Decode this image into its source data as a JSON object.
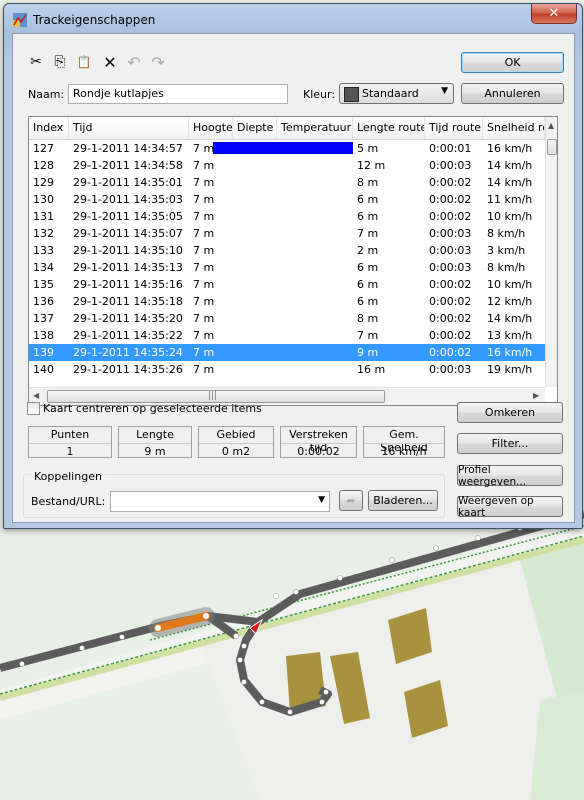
{
  "window": {
    "title": "Trackeigenschappen",
    "close_symbol": "✕"
  },
  "toolbar": {
    "cut": "✂",
    "copy": "⎘",
    "paste": "📋",
    "delete": "✕",
    "undo": "↶",
    "redo": "↷"
  },
  "buttons": {
    "ok": "OK",
    "cancel": "Annuleren",
    "reverse": "Omkeren",
    "filter": "Filter...",
    "profile": "Profiel weergeven...",
    "show_on_map": "Weergeven op kaart",
    "browse": "Bladeren..."
  },
  "form": {
    "name_label": "Naam:",
    "name_value": "Rondje kutlapjes",
    "color_label": "Kleur:",
    "color_value": "Standaard",
    "color_swatch": "#555555"
  },
  "table": {
    "columns": [
      "Index",
      "Tijd",
      "Hoogte",
      "Diepte",
      "Temperatuur",
      "Lengte route",
      "Tijd route",
      "Snelheid rou"
    ],
    "rows": [
      {
        "index": "127",
        "time": "29-1-2011 14:34:57",
        "height": "7 m",
        "depth": "",
        "temp": "",
        "length": "5 m",
        "duration": "0:00:01",
        "speed": "16 km/h"
      },
      {
        "index": "128",
        "time": "29-1-2011 14:34:58",
        "height": "7 m",
        "depth": "",
        "temp": "",
        "length": "12 m",
        "duration": "0:00:03",
        "speed": "14 km/h"
      },
      {
        "index": "129",
        "time": "29-1-2011 14:35:01",
        "height": "7 m",
        "depth": "",
        "temp": "",
        "length": "8 m",
        "duration": "0:00:02",
        "speed": "14 km/h"
      },
      {
        "index": "130",
        "time": "29-1-2011 14:35:03",
        "height": "7 m",
        "depth": "",
        "temp": "",
        "length": "6 m",
        "duration": "0:00:02",
        "speed": "11 km/h"
      },
      {
        "index": "131",
        "time": "29-1-2011 14:35:05",
        "height": "7 m",
        "depth": "",
        "temp": "",
        "length": "6 m",
        "duration": "0:00:02",
        "speed": "10 km/h"
      },
      {
        "index": "132",
        "time": "29-1-2011 14:35:07",
        "height": "7 m",
        "depth": "",
        "temp": "",
        "length": "7 m",
        "duration": "0:00:03",
        "speed": "8 km/h"
      },
      {
        "index": "133",
        "time": "29-1-2011 14:35:10",
        "height": "7 m",
        "depth": "",
        "temp": "",
        "length": "2 m",
        "duration": "0:00:03",
        "speed": "3 km/h"
      },
      {
        "index": "134",
        "time": "29-1-2011 14:35:13",
        "height": "7 m",
        "depth": "",
        "temp": "",
        "length": "6 m",
        "duration": "0:00:03",
        "speed": "8 km/h"
      },
      {
        "index": "135",
        "time": "29-1-2011 14:35:16",
        "height": "7 m",
        "depth": "",
        "temp": "",
        "length": "6 m",
        "duration": "0:00:02",
        "speed": "10 km/h"
      },
      {
        "index": "136",
        "time": "29-1-2011 14:35:18",
        "height": "7 m",
        "depth": "",
        "temp": "",
        "length": "6 m",
        "duration": "0:00:02",
        "speed": "12 km/h"
      },
      {
        "index": "137",
        "time": "29-1-2011 14:35:20",
        "height": "7 m",
        "depth": "",
        "temp": "",
        "length": "8 m",
        "duration": "0:00:02",
        "speed": "14 km/h"
      },
      {
        "index": "138",
        "time": "29-1-2011 14:35:22",
        "height": "7 m",
        "depth": "",
        "temp": "",
        "length": "7 m",
        "duration": "0:00:02",
        "speed": "13 km/h"
      },
      {
        "index": "139",
        "time": "29-1-2011 14:35:24",
        "height": "7 m",
        "depth": "",
        "temp": "",
        "length": "9 m",
        "duration": "0:00:02",
        "speed": "16 km/h",
        "selected": true
      },
      {
        "index": "140",
        "time": "29-1-2011 14:35:26",
        "height": "7 m",
        "depth": "",
        "temp": "",
        "length": "16 m",
        "duration": "0:00:03",
        "speed": "19 km/h"
      }
    ],
    "highlight_color": "#0000ff",
    "selection_color": "#3399ff"
  },
  "checkbox": {
    "center_map": "Kaart centreren op geselecteerde items",
    "checked": false
  },
  "stats": [
    {
      "label": "Punten",
      "value": "1"
    },
    {
      "label": "Lengte",
      "value": "9 m"
    },
    {
      "label": "Gebied",
      "value": "0 m2"
    },
    {
      "label": "Verstreken tijd",
      "value": "0:00:02"
    },
    {
      "label": "Gem. Snelheid",
      "value": "16 km/h"
    }
  ],
  "links": {
    "group_label": "Koppelingen",
    "file_label": "Bestand/URL:",
    "file_value": ""
  },
  "map": {
    "track_color": "#5a5a5a",
    "selected_segment_color": "#e07a1a",
    "building_color": "#a8923e",
    "background": "#e6efe3"
  }
}
